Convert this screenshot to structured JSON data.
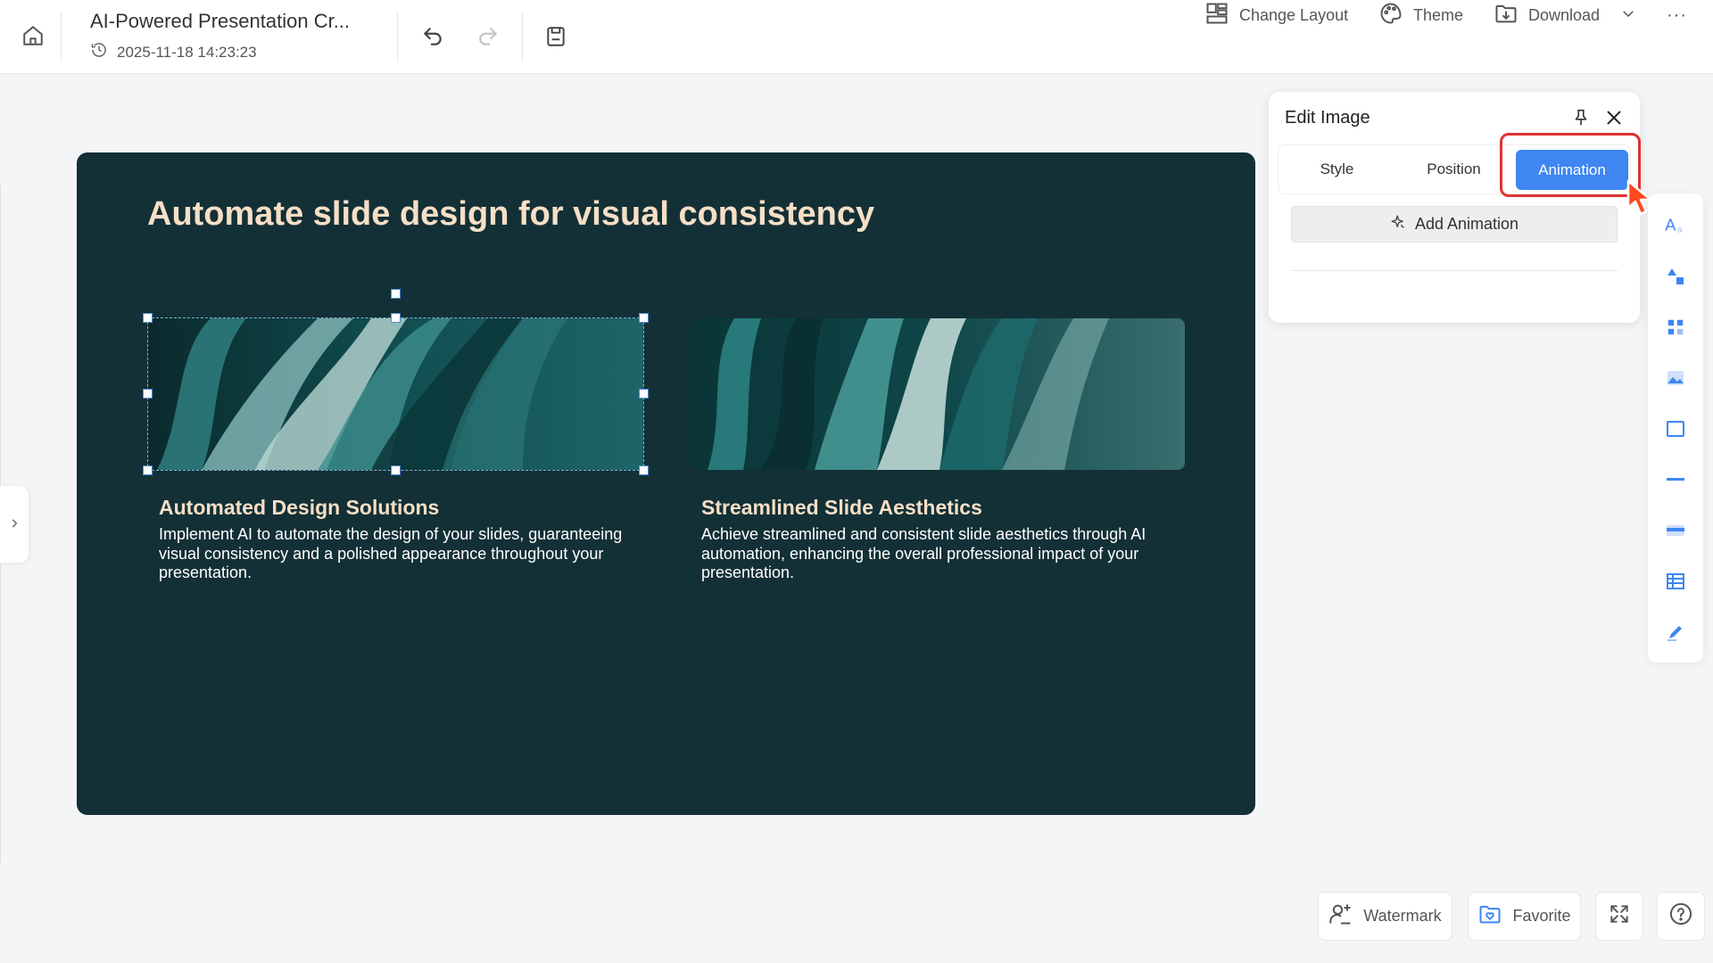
{
  "header": {
    "title": "AI-Powered Presentation Cr...",
    "timestamp": "2025-11-18 14:23:23",
    "change_layout": "Change Layout",
    "theme": "Theme",
    "download": "Download",
    "more": "···"
  },
  "slide": {
    "title": "Automate slide design for visual consistency",
    "cards": [
      {
        "heading": "Automated Design Solutions",
        "body": "Implement AI to automate the design of your slides, guaranteeing visual consistency and a polished appearance throughout your presentation."
      },
      {
        "heading": "Streamlined Slide Aesthetics",
        "body": "Achieve streamlined and consistent slide aesthetics through AI automation, enhancing the overall professional impact of your presentation."
      }
    ]
  },
  "edit_panel": {
    "title": "Edit Image",
    "tabs": [
      "Style",
      "Position",
      "Animation"
    ],
    "active_tab": "Animation",
    "add_animation": "Add Animation"
  },
  "bottom": {
    "watermark": "Watermark",
    "favorite": "Favorite"
  },
  "colors": {
    "slide_bg": "#133036",
    "title_color": "#f6dfc6",
    "accent": "#3f86f2",
    "highlight": "#e0322f"
  }
}
